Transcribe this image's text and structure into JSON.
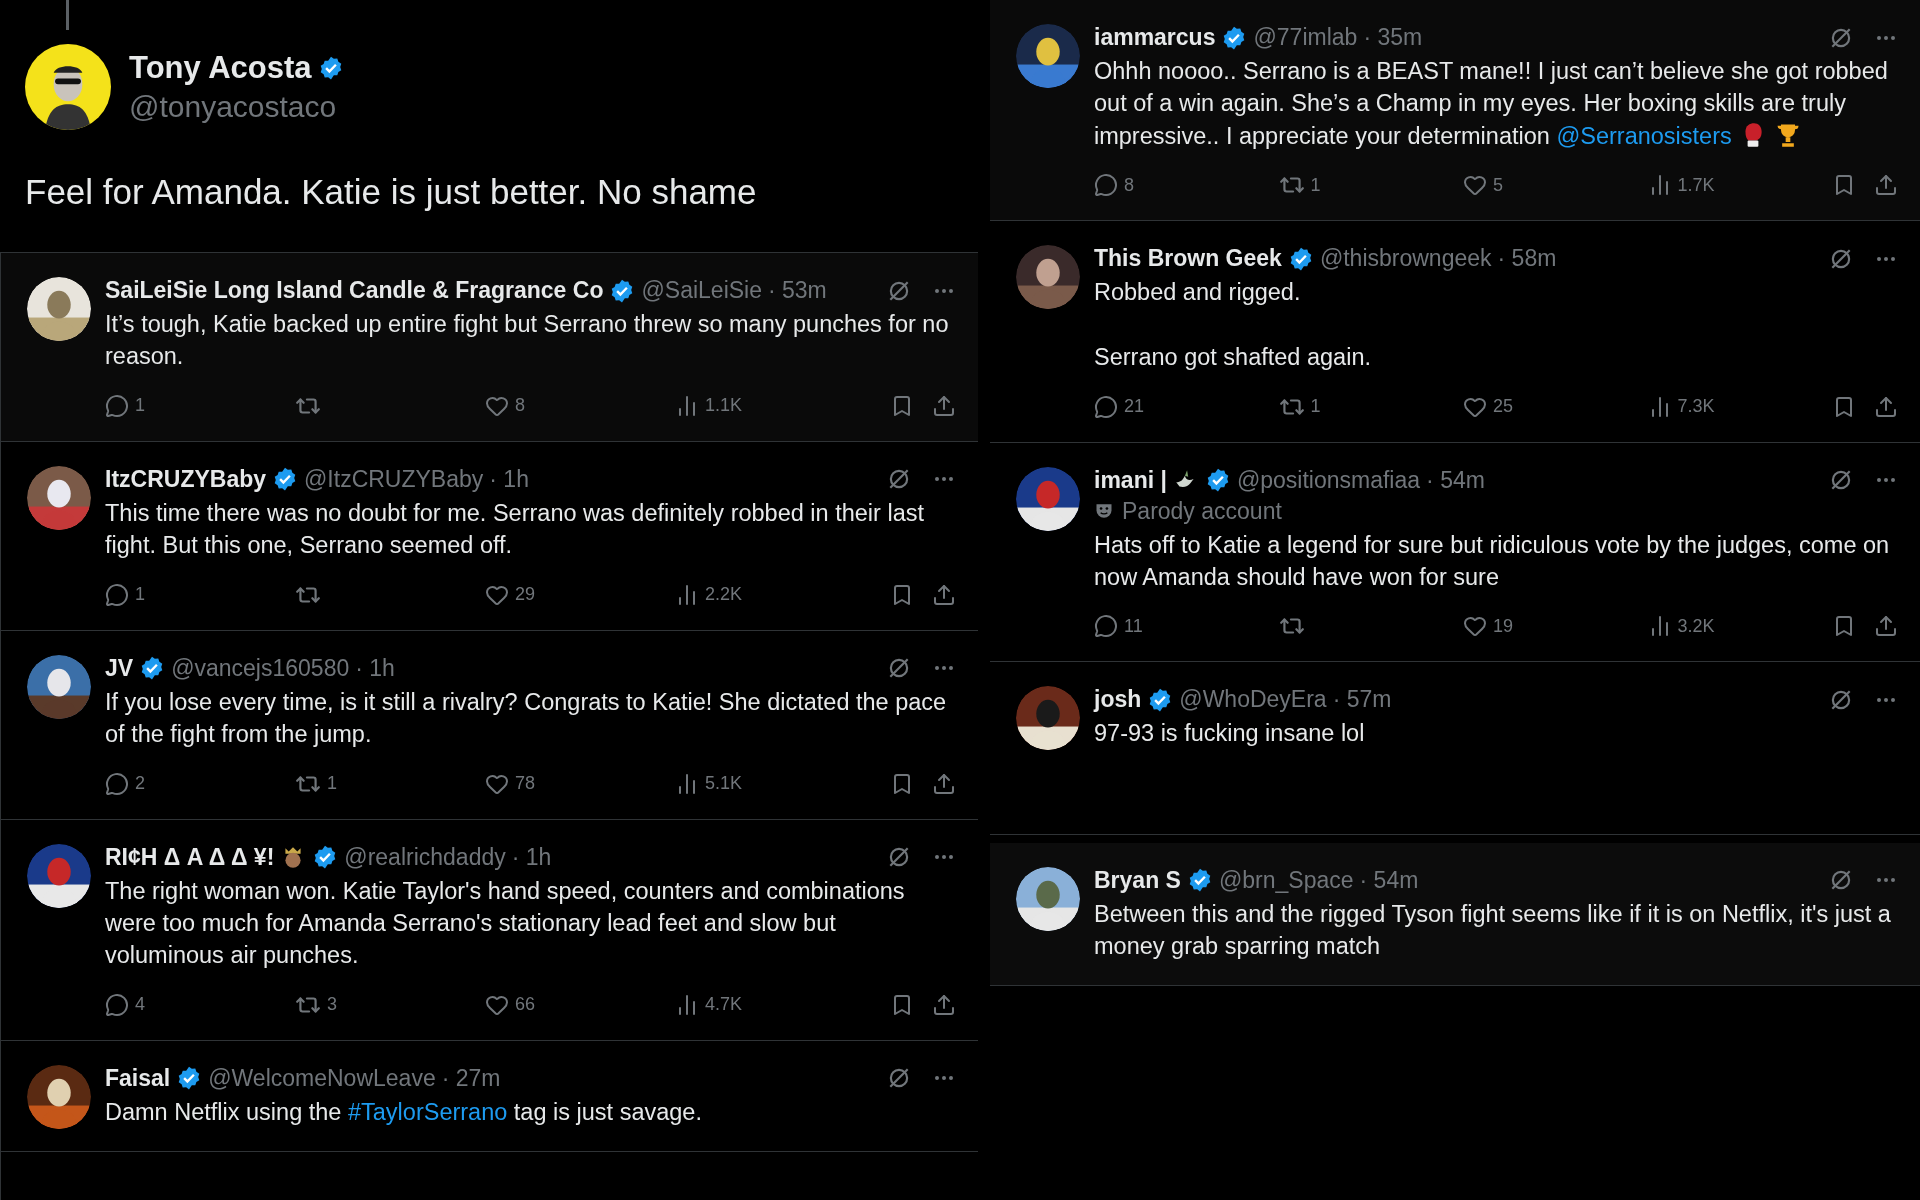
{
  "main_post": {
    "name": "Tony Acosta",
    "verified": true,
    "handle": "@tonyacostaco",
    "segments": [
      {
        "kind": "plain",
        "text": "Feel for Amanda. Katie is just better. No shame"
      }
    ]
  },
  "left_replies": [
    {
      "name": "SaiLeiSie Long Island Candle & Fragrance Co",
      "verified": true,
      "handle": "@SaiLeiSie",
      "time": "· 53m",
      "segments": [
        {
          "kind": "plain",
          "text": "It’s tough, Katie backed up entire fight but Serrano threw so many punches for no reason."
        }
      ],
      "stats": {
        "replies": "1",
        "likes": "8",
        "views": "1.1K"
      }
    },
    {
      "name": "ItzCRUZYBaby",
      "verified": true,
      "handle": "@ItzCRUZYBaby",
      "time": "· 1h",
      "segments": [
        {
          "kind": "plain",
          "text": "This time there was no doubt for me. Serrano was definitely robbed in their last fight. But this one, Serrano seemed off."
        }
      ],
      "stats": {
        "replies": "1",
        "likes": "29",
        "views": "2.2K"
      }
    },
    {
      "name": "JV",
      "verified": true,
      "handle": "@vancejs160580",
      "time": "· 1h",
      "segments": [
        {
          "kind": "plain",
          "text": "If you lose every time, is it still a rivalry? Congrats to Katie! She dictated the pace of the fight from the jump."
        }
      ],
      "stats": {
        "replies": "2",
        "reposts": "1",
        "likes": "78",
        "views": "5.1K"
      }
    },
    {
      "name": "RI¢H Δ A Δ Δ ¥!",
      "name_decor": {
        "kind": "crown"
      },
      "verified": true,
      "handle": "@realrichdaddy",
      "time": "· 1h",
      "segments": [
        {
          "kind": "plain",
          "text": "The right woman won. Katie Taylor's hand speed, counters and combinations were too much for Amanda Serrano's stationary lead feet and slow but voluminous air punches."
        }
      ],
      "stats": {
        "replies": "4",
        "reposts": "3",
        "likes": "66",
        "views": "4.7K"
      }
    },
    {
      "name": "Faisal",
      "verified": true,
      "handle": "@WelcomeNowLeave",
      "time": "· 27m",
      "segments": [
        {
          "kind": "plain",
          "text": "Damn Netflix using the "
        },
        {
          "kind": "link",
          "text": "#TaylorSerrano"
        },
        {
          "kind": "plain",
          "text": " tag is just savage."
        }
      ]
    }
  ],
  "right_replies": [
    {
      "name": "iammarcus",
      "verified": true,
      "handle": "@77imlab",
      "time": "· 35m",
      "segments": [
        {
          "kind": "plain",
          "text": "Ohhh noooo.. Serrano is a BEAST mane!! I just can’t believe she got robbed out of a win again. She’s a Champ in my eyes. Her boxing skills are truly impressive.. I appreciate your determination "
        },
        {
          "kind": "link",
          "text": "@Serranosisters"
        },
        {
          "kind": "glove"
        },
        {
          "kind": "trophy"
        }
      ],
      "stats": {
        "replies": "8",
        "reposts": "1",
        "likes": "5",
        "views": "1.7K"
      }
    },
    {
      "name": "This Brown Geek",
      "verified": true,
      "handle": "@thisbrowngeek",
      "time": "· 58m",
      "segments": [
        {
          "kind": "plain",
          "text": "Robbed and rigged.\n\nSerrano got shafted again."
        }
      ],
      "stats": {
        "replies": "21",
        "reposts": "1",
        "likes": "25",
        "views": "7.3K"
      }
    },
    {
      "name": "imani |",
      "name_decor": {
        "kind": "dove"
      },
      "verified": true,
      "handle": "@positionsmafiaa",
      "time": "· 54m",
      "label": "Parody account",
      "segments": [
        {
          "kind": "plain",
          "text": "Hats off to Katie a legend for sure but ridiculous vote by the judges, come on now Amanda should have won for sure"
        }
      ],
      "stats": {
        "replies": "11",
        "likes": "19",
        "views": "3.2K"
      }
    },
    {
      "name": "josh",
      "verified": true,
      "handle": "@WhoDeyEra",
      "time": "· 57m",
      "segments": [
        {
          "kind": "plain",
          "text": "97-93 is fucking insane lol"
        }
      ],
      "cut": true
    },
    {
      "name": "Bryan S",
      "verified": true,
      "handle": "@brn_Space",
      "time": "· 54m",
      "segments": [
        {
          "kind": "plain",
          "text": "Between this and the rigged Tyson fight seems like if it is on Netflix, it's just a money grab sparring match"
        }
      ],
      "separate": true
    }
  ]
}
